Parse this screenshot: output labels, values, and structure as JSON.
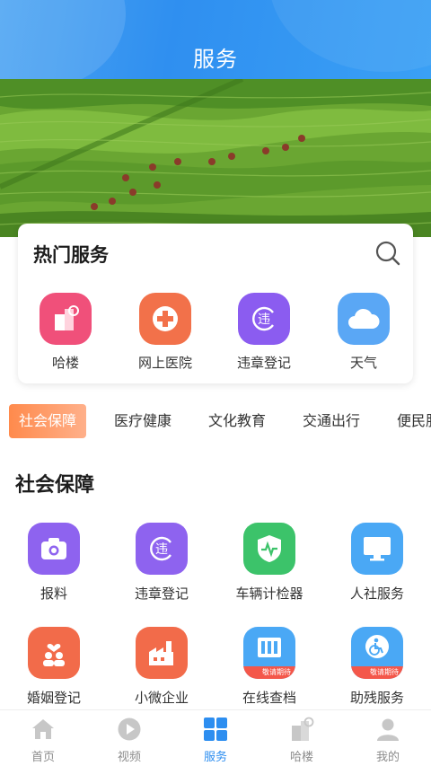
{
  "header": {
    "title": "服务"
  },
  "hot_services": {
    "title": "热门服务",
    "items": [
      {
        "label": "哈楼",
        "icon": "building-icon",
        "color": "#f0507a"
      },
      {
        "label": "网上医院",
        "icon": "medical-cross-icon",
        "color": "#f2714a"
      },
      {
        "label": "违章登记",
        "icon": "traffic-violation-icon",
        "color": "#8b5cf0"
      },
      {
        "label": "天气",
        "icon": "cloud-icon",
        "color": "#5aa7f5"
      }
    ]
  },
  "category_tabs": [
    {
      "label": "社会保障",
      "active": true
    },
    {
      "label": "医疗健康",
      "active": false
    },
    {
      "label": "文化教育",
      "active": false
    },
    {
      "label": "交通出行",
      "active": false
    },
    {
      "label": "便民服",
      "active": false
    }
  ],
  "section": {
    "title": "社会保障",
    "items": [
      {
        "label": "报料",
        "icon": "camera-icon",
        "color": "#8e63ef"
      },
      {
        "label": "违章登记",
        "icon": "traffic-violation-icon",
        "color": "#8e63ef"
      },
      {
        "label": "车辆计检器",
        "icon": "shield-pulse-icon",
        "color": "#3cc36a"
      },
      {
        "label": "人社服务",
        "icon": "monitor-icon",
        "color": "#4aa8f5"
      },
      {
        "label": "婚姻登记",
        "icon": "couple-heart-icon",
        "color": "#f26b4a"
      },
      {
        "label": "小微企业",
        "icon": "factory-icon",
        "color": "#f26b4a"
      },
      {
        "label": "在线查档",
        "icon": "archive-icon",
        "color": "#4aa8f5",
        "badge": "敬请期待"
      },
      {
        "label": "助残服务",
        "icon": "wheelchair-icon",
        "color": "#4aa8f5",
        "badge": "敬请期待"
      }
    ]
  },
  "bottom_nav": [
    {
      "label": "首页",
      "icon": "home-icon",
      "active": false
    },
    {
      "label": "视频",
      "icon": "play-icon",
      "active": false
    },
    {
      "label": "服务",
      "icon": "grid-icon",
      "active": true
    },
    {
      "label": "哈楼",
      "icon": "building-icon",
      "active": false
    },
    {
      "label": "我的",
      "icon": "user-icon",
      "active": false
    }
  ]
}
